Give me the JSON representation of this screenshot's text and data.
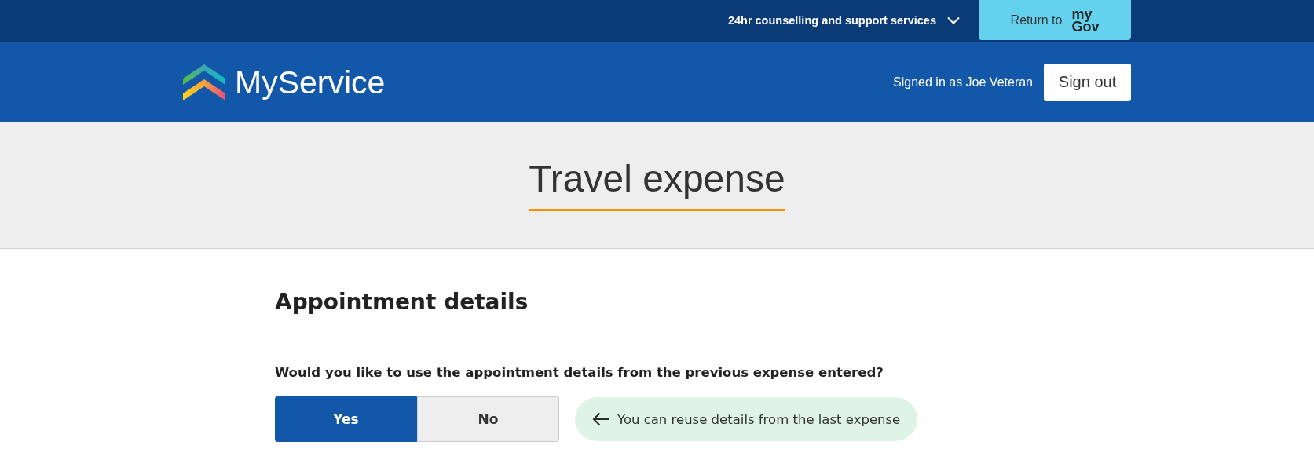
{
  "top_bar": {
    "support_menu": {
      "label": "24hr counselling and support services",
      "expanded": false
    },
    "return_button": {
      "label": "Return to",
      "logo_top": "my",
      "logo_bottom": "Gov"
    }
  },
  "header": {
    "logo_text": "MyService",
    "signed_in": "Signed in as Joe Veteran",
    "sign_out": "Sign out"
  },
  "hero": {
    "title": "Travel expense"
  },
  "section": {
    "heading": "Appointment details",
    "question": "Would you like to use the appointment details from the previous expense entered?",
    "options": [
      {
        "label": "Yes",
        "selected": true
      },
      {
        "label": "No",
        "selected": false
      }
    ],
    "hint": "You can reuse details from the last expense"
  }
}
